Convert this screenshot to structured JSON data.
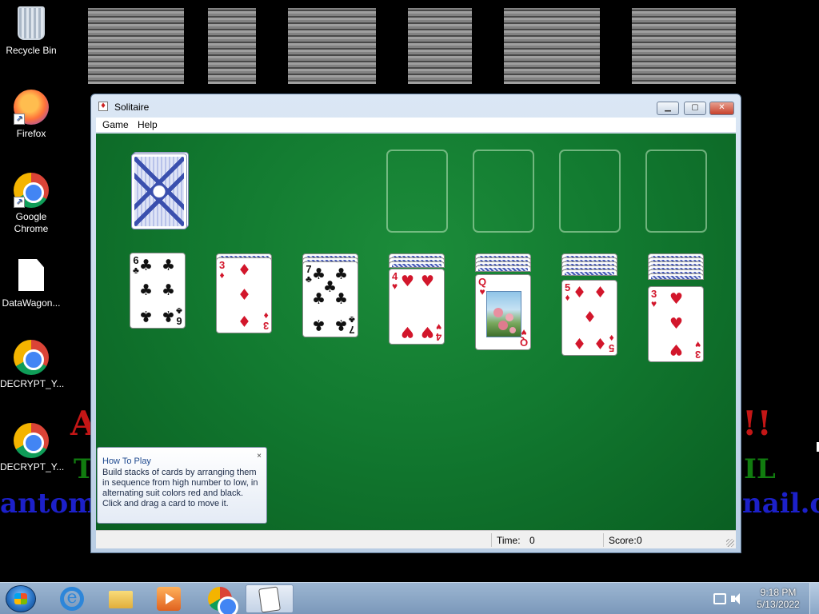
{
  "wallpaper": {
    "line_red": "A",
    "line_red_end": "!!",
    "line_green": "T",
    "line_green_end": "IL",
    "line_blue": "antom",
    "line_blue_end": "nail.c"
  },
  "desktop": {
    "icons": [
      {
        "label": "Recycle Bin",
        "icon": "recycle-bin-icon"
      },
      {
        "label": "Firefox",
        "icon": "firefox-icon"
      },
      {
        "label": "Google Chrome",
        "icon": "chrome-icon"
      },
      {
        "label": "DataWagon...",
        "icon": "document-icon"
      },
      {
        "label": "DECRYPT_Y...",
        "icon": "chrome-icon"
      },
      {
        "label": "DECRYPT_Y...",
        "icon": "chrome-icon"
      }
    ]
  },
  "window": {
    "title": "Solitaire",
    "controls": {
      "minimize": "▁",
      "maximize": "▢",
      "close": "✕"
    },
    "menu": [
      "Game",
      "Help"
    ]
  },
  "game": {
    "tableau": [
      {
        "rank": "6",
        "suit": "♣",
        "color": "black",
        "hidden": 0
      },
      {
        "rank": "3",
        "suit": "♦",
        "color": "red",
        "hidden": 1
      },
      {
        "rank": "7",
        "suit": "♣",
        "color": "black",
        "hidden": 2
      },
      {
        "rank": "4",
        "suit": "♥",
        "color": "red",
        "hidden": 3
      },
      {
        "rank": "Q",
        "suit": "♥",
        "color": "red",
        "hidden": 4
      },
      {
        "rank": "5",
        "suit": "♦",
        "color": "red",
        "hidden": 5
      },
      {
        "rank": "3",
        "suit": "♥",
        "color": "red",
        "hidden": 6
      }
    ],
    "foundation_slots": 4,
    "colors": {
      "felt": "#127a30",
      "red_suit": "#d2162b",
      "card_back": "#4458b6"
    }
  },
  "tooltip": {
    "title": "How To Play",
    "body": "Build stacks of cards by arranging them in sequence from high number to low, in alternating suit colors red and black. Click and drag a card to move it.",
    "close": "×"
  },
  "status": {
    "time_label": "Time:",
    "time_value": "0",
    "score_label": "Score:",
    "score_value": "0"
  },
  "taskbar": {
    "apps": [
      "internet-explorer-icon",
      "file-explorer-icon",
      "media-player-icon",
      "chrome-icon",
      "solitaire-icon"
    ],
    "active_app": "solitaire-icon",
    "clock_time": "9:18 PM",
    "clock_date": "5/13/2022"
  }
}
